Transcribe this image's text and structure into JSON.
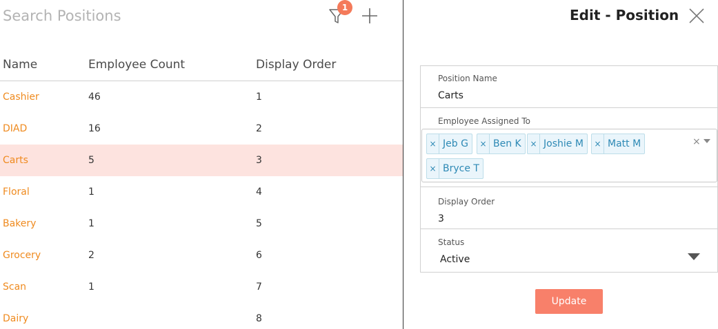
{
  "search": {
    "placeholder": "Search Positions"
  },
  "filter": {
    "badge_count": "1",
    "icon": "funnel-icon"
  },
  "add": {
    "icon": "plus-icon"
  },
  "table": {
    "headers": {
      "name": "Name",
      "count": "Employee Count",
      "order": "Display Order"
    },
    "rows": [
      {
        "name": "Cashier",
        "count": "46",
        "order": "1"
      },
      {
        "name": "DIAD",
        "count": "16",
        "order": "2"
      },
      {
        "name": "Carts",
        "count": "5",
        "order": "3"
      },
      {
        "name": "Floral",
        "count": "1",
        "order": "4"
      },
      {
        "name": "Bakery",
        "count": "1",
        "order": "5"
      },
      {
        "name": "Grocery",
        "count": "2",
        "order": "6"
      },
      {
        "name": "Scan",
        "count": "1",
        "order": "7"
      },
      {
        "name": "Dairy",
        "count": "",
        "order": "8"
      }
    ],
    "selected_row": "Carts"
  },
  "panel": {
    "title": "Edit - Position",
    "close_icon": "close-icon",
    "position_name": {
      "label": "Position Name",
      "value": "Carts"
    },
    "employees": {
      "label": "Employee Assigned To",
      "tags": [
        "Jeb G",
        "Ben K",
        "Joshie M",
        "Matt M",
        "Bryce T"
      ],
      "remove_glyph": "×",
      "clear_glyph": "×"
    },
    "display_order": {
      "label": "Display Order",
      "value": "3"
    },
    "status": {
      "label": "Status",
      "value": "Active"
    },
    "update_label": "Update"
  },
  "colors": {
    "accent": "#f8806a",
    "link": "#ef8a1e",
    "selected_row": "#fde3df",
    "tag_text": "#2d89b5",
    "tag_bg": "#eaf5fb"
  }
}
